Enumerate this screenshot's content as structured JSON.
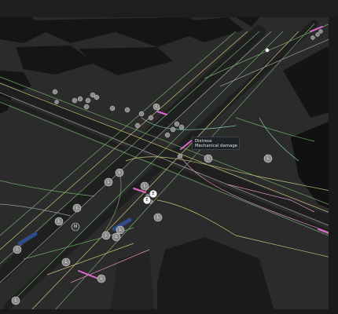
{
  "tooltip": {
    "line1": "Distress",
    "line2": "Mechanical damage"
  },
  "markers": [
    {
      "label": "L",
      "kind": "gray"
    },
    {
      "label": "L",
      "kind": "gray"
    },
    {
      "label": "L",
      "kind": "gray"
    },
    {
      "label": "L",
      "kind": "gray"
    },
    {
      "label": "L",
      "kind": "gray"
    },
    {
      "label": "M",
      "kind": "dark"
    },
    {
      "label": "L",
      "kind": "gray"
    },
    {
      "label": "L",
      "kind": "gray"
    },
    {
      "label": "L",
      "kind": "gray"
    },
    {
      "label": "L",
      "kind": "gray"
    },
    {
      "label": "L",
      "kind": "gray"
    },
    {
      "label": "L",
      "kind": "gray"
    },
    {
      "label": "E",
      "kind": "white"
    },
    {
      "label": "E",
      "kind": "white"
    },
    {
      "label": "L",
      "kind": "gray"
    },
    {
      "label": "L",
      "kind": "gray"
    },
    {
      "label": "L",
      "kind": "gray"
    },
    {
      "label": "L",
      "kind": "gray"
    },
    {
      "label": "L",
      "kind": "gray"
    },
    {
      "label": "L",
      "kind": "gray"
    },
    {
      "label": "L",
      "kind": "gray"
    }
  ],
  "colors": {
    "background": "#2b2b2b",
    "building": "#151515",
    "road_dark": "#1c1c1c",
    "line_green": "#6fa86a",
    "line_yellow": "#c9c27a",
    "line_pink": "#d98ec0",
    "line_gray": "#9a9a9a",
    "line_teal": "#7fc6b8",
    "marker_gray": "#8a8a8a",
    "marker_white": "#f2f2f2",
    "highlight_pink": "#e06ad0",
    "highlight_blue": "#2f4b8a"
  }
}
